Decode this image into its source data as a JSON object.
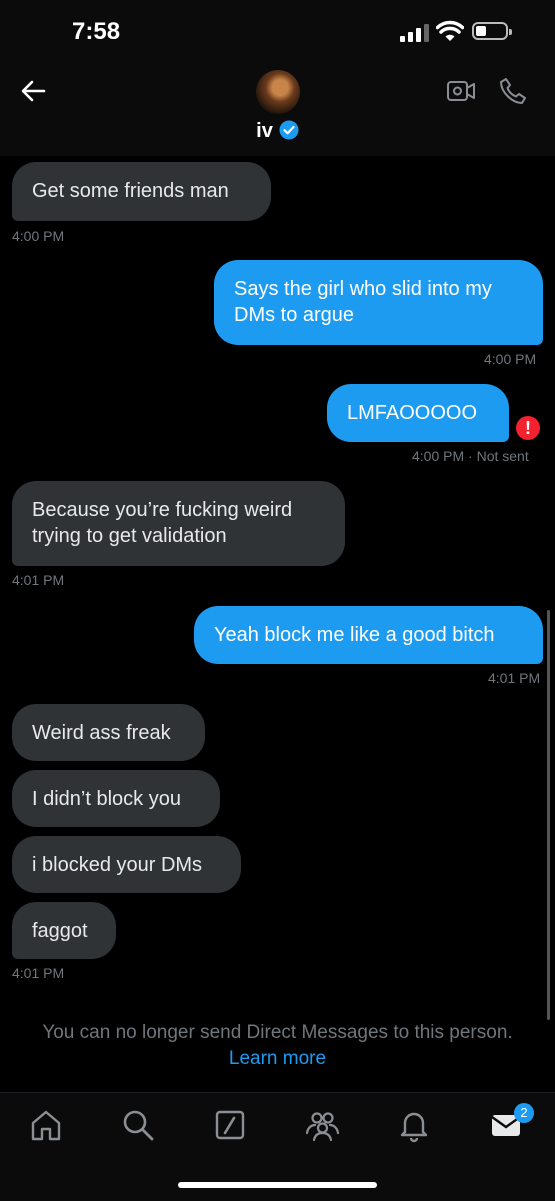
{
  "status_bar": {
    "time": "7:58"
  },
  "header": {
    "name": "iv"
  },
  "messages": [
    {
      "text": "Get some friends man",
      "time": "4:00 PM"
    },
    {
      "text": "Says the girl who slid into my DMs to argue",
      "time": "4:00 PM"
    },
    {
      "text": "LMFAOOOOO",
      "time": "4:00 PM",
      "status": "· Not sent"
    },
    {
      "text": "Because you’re fucking weird trying to get validation",
      "time": "4:01 PM"
    },
    {
      "text": "Yeah block me like a good bitch",
      "time": "4:01 PM"
    },
    {
      "text": "Weird ass freak"
    },
    {
      "text": "I didn’t block you"
    },
    {
      "text": "i blocked your DMs"
    },
    {
      "text": "faggot",
      "time": "4:01 PM"
    }
  ],
  "notice": {
    "text": "You can no longer send Direct Messages to this person.",
    "link": "Learn more"
  },
  "tabbar": {
    "messages_badge": "2"
  },
  "colors": {
    "sent_bubble": "#1d9bf0",
    "received_bubble": "#2f3336",
    "error": "#f4212e"
  }
}
